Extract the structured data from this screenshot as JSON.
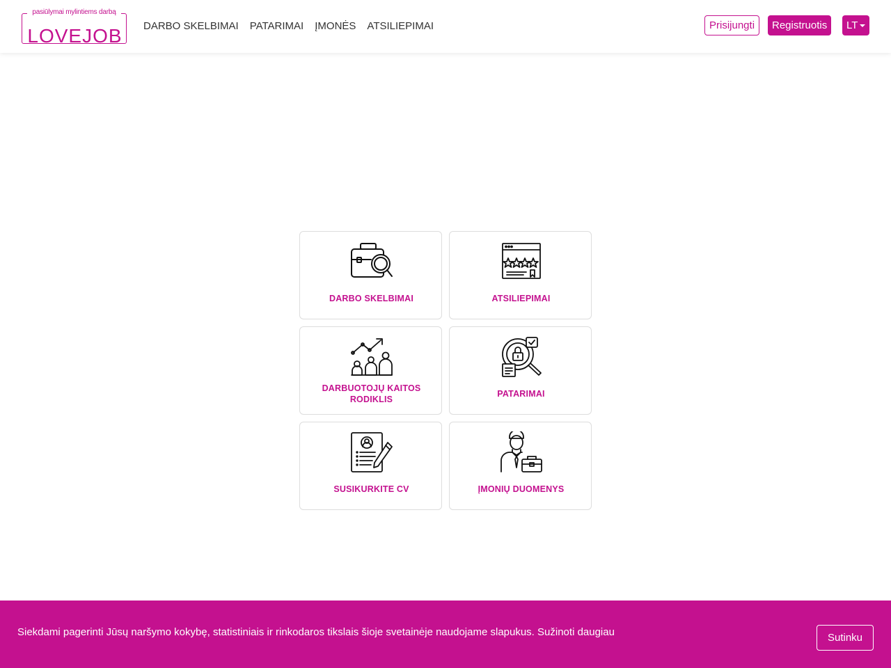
{
  "brand": {
    "tagline": "pasiūlymai mylintiems darbą",
    "wordmark": "LOVEJOB",
    "color": "#c4118f"
  },
  "nav": {
    "links": [
      "DARBO SKELBIMAI",
      "PATARIMAI",
      "ĮMONĖS",
      "ATSILIEPIMAI"
    ],
    "login_label": "Prisijungti",
    "register_label": "Registruotis",
    "language_label": "LT"
  },
  "tiles": [
    {
      "label": "DARBO SKELBIMAI",
      "icon": "briefcase-search-icon"
    },
    {
      "label": "ATSILIEPIMAI",
      "icon": "reviews-stars-icon"
    },
    {
      "label": "DARBUOTOJŲ KAITOS RODIKLIS",
      "icon": "growth-chart-people-icon"
    },
    {
      "label": "PATARIMAI",
      "icon": "secure-search-icon"
    },
    {
      "label": "SUSIKURKITE CV",
      "icon": "cv-document-icon"
    },
    {
      "label": "ĮMONIŲ DUOMENYS",
      "icon": "businessman-icon"
    }
  ],
  "cookie": {
    "text": "Siekdami pagerinti Jūsų naršymo kokybę, statistiniais ir rinkodaros tikslais šioje svetainėje naudojame slapukus.",
    "link_label": "Sužinoti daugiau",
    "accept_label": "Sutinku"
  }
}
